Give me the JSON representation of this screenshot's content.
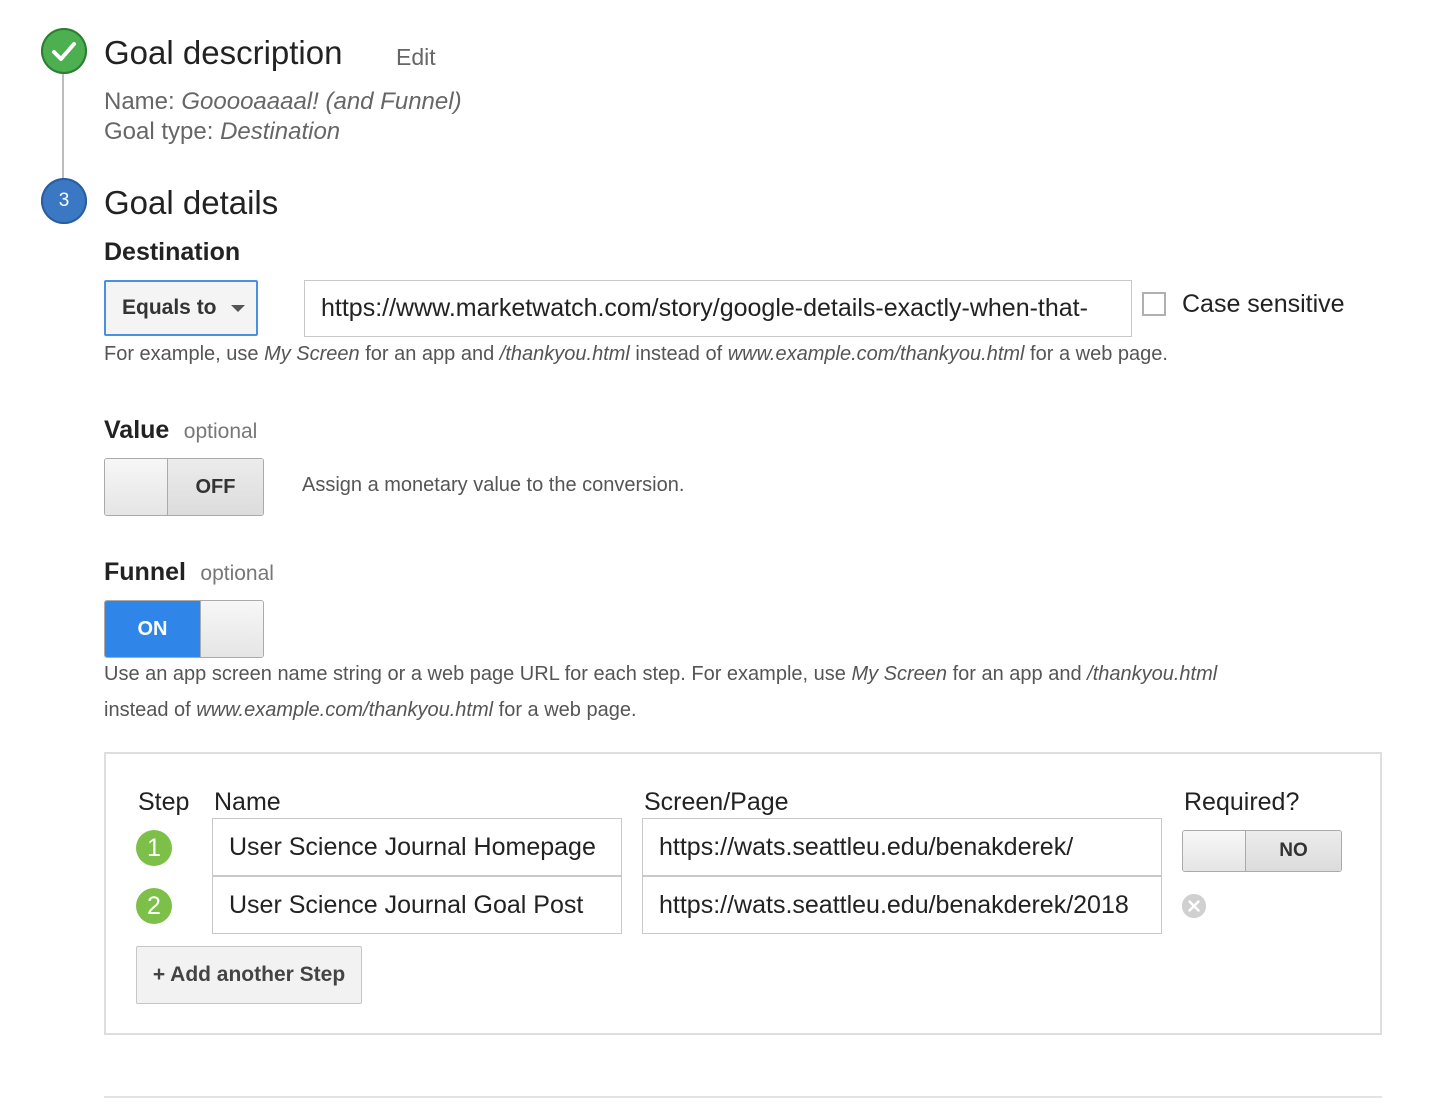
{
  "goal_description": {
    "title": "Goal description",
    "edit_label": "Edit",
    "name_label": "Name:",
    "name_value": "Gooooaaaal! (and Funnel)",
    "type_label": "Goal type:",
    "type_value": "Destination"
  },
  "goal_details": {
    "step_number": "3",
    "title": "Goal details",
    "destination": {
      "label": "Destination",
      "match_type": "Equals to",
      "url_value": "https://www.marketwatch.com/story/google-details-exactly-when-that-",
      "case_sensitive_label": "Case sensitive",
      "case_sensitive_checked": false,
      "hint_parts": [
        "For example, use ",
        "My Screen",
        " for an app and ",
        "/thankyou.html",
        " instead of ",
        "www.example.com/thankyou.html",
        " for a web page."
      ]
    },
    "value": {
      "label": "Value",
      "optional": "optional",
      "toggle_state": "OFF",
      "hint": "Assign a monetary value to the conversion."
    },
    "funnel": {
      "label": "Funnel",
      "optional": "optional",
      "toggle_state": "ON",
      "hint_line1_parts": [
        "Use an app screen name string or a web page URL for each step. For example, use ",
        "My Screen",
        " for an app and ",
        "/thankyou.html"
      ],
      "hint_line2_parts": [
        "instead of ",
        "www.example.com/thankyou.html",
        " for a web page."
      ],
      "table": {
        "headers": {
          "step": "Step",
          "name": "Name",
          "screen": "Screen/Page",
          "required": "Required?"
        },
        "rows": [
          {
            "step": "1",
            "name": "User Science Journal Homepage",
            "screen": "https://wats.seattleu.edu/benakderek/"
          },
          {
            "step": "2",
            "name": "User Science Journal Goal Post",
            "screen": "https://wats.seattleu.edu/benakderek/2018"
          }
        ],
        "required_state": "NO",
        "remove_icon": "close-circle-icon",
        "add_step_label": "+ Add another Step"
      }
    }
  },
  "colors": {
    "check_green": "#4caf50",
    "step_blue": "#3b78c3",
    "toggle_on_blue": "#2f86e8",
    "badge_green": "#7cc04a"
  }
}
